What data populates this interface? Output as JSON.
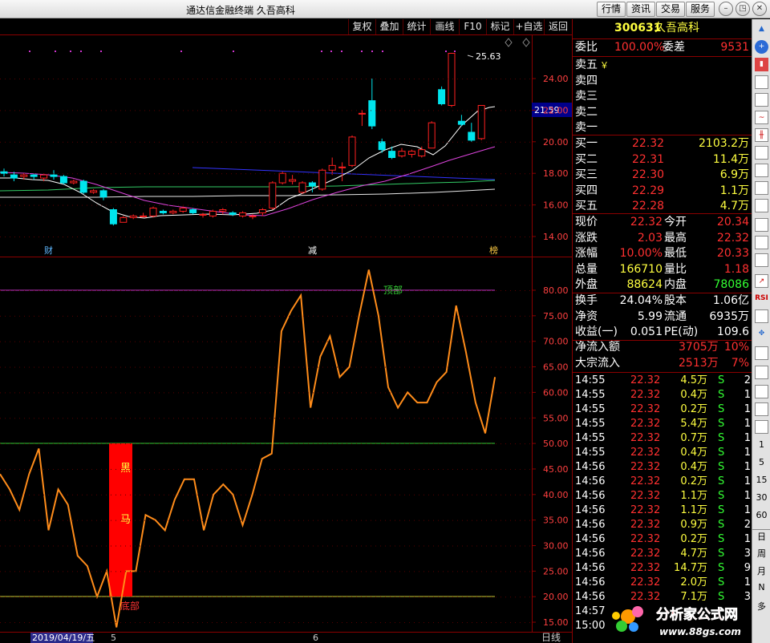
{
  "app": {
    "title": "通达信金融终端 久吾高科",
    "buttons": [
      "行情",
      "资讯",
      "交易",
      "服务"
    ]
  },
  "toolbar": {
    "items": [
      "复权",
      "叠加",
      "统计",
      "画线",
      "F10",
      "标记",
      "+自选",
      "返回"
    ]
  },
  "kline": {
    "price_axis": [
      "24.00",
      "22.00",
      "20.00",
      "18.00",
      "16.00",
      "14.00"
    ],
    "high_label": "25.63",
    "current_price_tag": "21.59",
    "markers": [
      "财",
      "减",
      "榜"
    ],
    "candles": [
      {
        "o": 18.1,
        "c": 18.0,
        "h": 18.3,
        "l": 17.8
      },
      {
        "o": 17.9,
        "c": 17.7,
        "h": 18.1,
        "l": 17.5
      },
      {
        "o": 17.8,
        "c": 17.9,
        "h": 18.0,
        "l": 17.6
      },
      {
        "o": 17.9,
        "c": 17.8,
        "h": 18.0,
        "l": 17.6
      },
      {
        "o": 17.7,
        "c": 17.9,
        "h": 18.0,
        "l": 17.5
      },
      {
        "o": 17.9,
        "c": 17.8,
        "h": 18.2,
        "l": 17.6
      },
      {
        "o": 17.8,
        "c": 17.4,
        "h": 17.9,
        "l": 17.3
      },
      {
        "o": 17.4,
        "c": 17.5,
        "h": 17.6,
        "l": 17.3
      },
      {
        "o": 17.5,
        "c": 16.8,
        "h": 17.6,
        "l": 16.7
      },
      {
        "o": 16.8,
        "c": 16.9,
        "h": 17.0,
        "l": 16.7
      },
      {
        "o": 16.9,
        "c": 16.5,
        "h": 17.0,
        "l": 16.3
      },
      {
        "o": 15.7,
        "c": 14.8,
        "h": 15.8,
        "l": 14.7
      },
      {
        "o": 14.9,
        "c": 15.2,
        "h": 15.3,
        "l": 14.9
      },
      {
        "o": 15.2,
        "c": 15.3,
        "h": 15.4,
        "l": 15.1
      },
      {
        "o": 15.3,
        "c": 15.3,
        "h": 15.5,
        "l": 15.2
      },
      {
        "o": 15.3,
        "c": 15.8,
        "h": 15.9,
        "l": 15.2
      },
      {
        "o": 15.6,
        "c": 15.5,
        "h": 15.7,
        "l": 15.4
      },
      {
        "o": 15.5,
        "c": 15.6,
        "h": 15.7,
        "l": 15.4
      },
      {
        "o": 15.6,
        "c": 15.8,
        "h": 15.9,
        "l": 15.5
      },
      {
        "o": 15.7,
        "c": 15.5,
        "h": 15.8,
        "l": 15.4
      },
      {
        "o": 15.4,
        "c": 15.4,
        "h": 15.5,
        "l": 15.2
      },
      {
        "o": 15.3,
        "c": 15.6,
        "h": 15.7,
        "l": 15.2
      },
      {
        "o": 15.6,
        "c": 15.7,
        "h": 15.8,
        "l": 15.4
      },
      {
        "o": 15.5,
        "c": 15.4,
        "h": 15.6,
        "l": 15.3
      },
      {
        "o": 15.3,
        "c": 15.5,
        "h": 15.6,
        "l": 15.2
      },
      {
        "o": 15.3,
        "c": 15.3,
        "h": 15.4,
        "l": 15.1
      },
      {
        "o": 15.5,
        "c": 15.7,
        "h": 15.8,
        "l": 15.3
      },
      {
        "o": 15.8,
        "c": 17.4,
        "h": 17.5,
        "l": 15.7
      },
      {
        "o": 17.4,
        "c": 18.0,
        "h": 18.1,
        "l": 17.3
      },
      {
        "o": 17.5,
        "c": 17.6,
        "h": 17.9,
        "l": 17.3
      },
      {
        "o": 16.8,
        "c": 17.4,
        "h": 17.5,
        "l": 16.7
      },
      {
        "o": 17.4,
        "c": 17.2,
        "h": 17.5,
        "l": 16.8
      },
      {
        "o": 17.0,
        "c": 18.2,
        "h": 18.3,
        "l": 16.9
      },
      {
        "o": 18.2,
        "c": 18.5,
        "h": 19.0,
        "l": 17.9
      },
      {
        "o": 18.4,
        "c": 18.4,
        "h": 18.7,
        "l": 17.5
      },
      {
        "o": 18.5,
        "c": 20.3,
        "h": 20.4,
        "l": 18.4
      },
      {
        "o": 21.8,
        "c": 21.8,
        "h": 22.0,
        "l": 21.0
      },
      {
        "o": 22.6,
        "c": 21.0,
        "h": 24.0,
        "l": 20.8
      },
      {
        "o": 20.0,
        "c": 19.5,
        "h": 20.2,
        "l": 19.3
      },
      {
        "o": 19.4,
        "c": 19.0,
        "h": 19.7,
        "l": 18.9
      },
      {
        "o": 19.1,
        "c": 19.4,
        "h": 19.6,
        "l": 19.0
      },
      {
        "o": 19.2,
        "c": 19.4,
        "h": 19.5,
        "l": 19.0
      },
      {
        "o": 19.1,
        "c": 19.5,
        "h": 19.7,
        "l": 19.0
      },
      {
        "o": 19.6,
        "c": 21.2,
        "h": 21.3,
        "l": 19.6
      },
      {
        "o": 23.3,
        "c": 22.4,
        "h": 23.5,
        "l": 22.3
      },
      {
        "o": 22.3,
        "c": 25.6,
        "h": 25.63,
        "l": 22.2
      },
      {
        "o": 21.3,
        "c": 21.1,
        "h": 21.7,
        "l": 21.0
      },
      {
        "o": 20.6,
        "c": 20.1,
        "h": 21.2,
        "l": 20.0
      },
      {
        "o": 20.2,
        "c": 22.3,
        "h": 22.3,
        "l": 20.1
      }
    ]
  },
  "indicator": {
    "axis": [
      "80.00",
      "75.00",
      "70.00",
      "65.00",
      "60.00",
      "55.00",
      "50.00",
      "45.00",
      "40.00",
      "35.00",
      "30.00",
      "25.00",
      "20.00",
      "15.00"
    ],
    "label_top": "顶部",
    "label_bottom": "底部",
    "bar_text": [
      "黑",
      "马"
    ],
    "series": [
      44,
      41,
      37,
      44,
      49,
      33,
      41,
      38,
      28,
      26,
      20,
      25,
      14,
      25,
      25,
      36,
      35,
      33,
      39,
      43,
      43,
      33,
      40,
      42,
      40,
      34,
      40,
      47,
      48,
      72,
      76,
      79,
      57,
      67,
      71,
      63,
      65,
      75,
      84,
      75,
      61,
      57,
      60,
      58,
      58,
      62,
      64,
      77,
      68,
      58,
      52,
      63
    ]
  },
  "footer": {
    "date": "2019/04/19/五",
    "month_labels": [
      "5",
      "6"
    ],
    "period": "日线"
  },
  "quote": {
    "code": "300631",
    "name": "久吾高科",
    "weibi": {
      "label": "委比",
      "value": "100.00%",
      "label2": "委差",
      "value2": "9531"
    },
    "sells": [
      {
        "label": "卖五",
        "suffix": "￥"
      },
      {
        "label": "卖四",
        "suffix": ""
      },
      {
        "label": "卖三",
        "suffix": ""
      },
      {
        "label": "卖二",
        "suffix": ""
      },
      {
        "label": "卖一",
        "suffix": ""
      }
    ],
    "buys": [
      {
        "label": "买一",
        "price": "22.32",
        "vol": "2103.2万"
      },
      {
        "label": "买二",
        "price": "22.31",
        "vol": "11.4万"
      },
      {
        "label": "买三",
        "price": "22.30",
        "vol": "6.9万"
      },
      {
        "label": "买四",
        "price": "22.29",
        "vol": "1.1万"
      },
      {
        "label": "买五",
        "price": "22.28",
        "vol": "4.7万"
      }
    ],
    "stats": [
      {
        "l1": "现价",
        "v1": "22.32",
        "l2": "今开",
        "v2": "20.34"
      },
      {
        "l1": "涨跌",
        "v1": "2.03",
        "l2": "最高",
        "v2": "22.32"
      },
      {
        "l1": "涨幅",
        "v1": "10.00%",
        "l2": "最低",
        "v2": "20.33"
      },
      {
        "l1": "总量",
        "v1": "166710",
        "l2": "量比",
        "v2": "1.18"
      },
      {
        "l1": "外盘",
        "v1": "88624",
        "l2": "内盘",
        "v2": "78086"
      }
    ],
    "stats2": [
      {
        "l1": "换手",
        "v1": "24.04%",
        "l2": "股本",
        "v2": "1.06亿"
      },
      {
        "l1": "净资",
        "v1": "5.99",
        "l2": "流通",
        "v2": "6935万"
      },
      {
        "l1": "收益(一)",
        "v1": "0.051",
        "l2": "PE(动)",
        "v2": "109.6"
      }
    ],
    "flows": [
      {
        "label": "净流入额",
        "value": "3705万",
        "pct": "10%"
      },
      {
        "label": "大宗流入",
        "value": "2513万",
        "pct": "7%"
      }
    ],
    "ticks": [
      {
        "t": "14:55",
        "p": "22.32",
        "v": "4.5万",
        "f": "S",
        "n": "2"
      },
      {
        "t": "14:55",
        "p": "22.32",
        "v": "0.4万",
        "f": "S",
        "n": "1"
      },
      {
        "t": "14:55",
        "p": "22.32",
        "v": "0.2万",
        "f": "S",
        "n": "1"
      },
      {
        "t": "14:55",
        "p": "22.32",
        "v": "5.4万",
        "f": "S",
        "n": "1"
      },
      {
        "t": "14:55",
        "p": "22.32",
        "v": "0.7万",
        "f": "S",
        "n": "1"
      },
      {
        "t": "14:55",
        "p": "22.32",
        "v": "0.4万",
        "f": "S",
        "n": "1"
      },
      {
        "t": "14:56",
        "p": "22.32",
        "v": "0.4万",
        "f": "S",
        "n": "1"
      },
      {
        "t": "14:56",
        "p": "22.32",
        "v": "0.2万",
        "f": "S",
        "n": "1"
      },
      {
        "t": "14:56",
        "p": "22.32",
        "v": "1.1万",
        "f": "S",
        "n": "1"
      },
      {
        "t": "14:56",
        "p": "22.32",
        "v": "1.1万",
        "f": "S",
        "n": "1"
      },
      {
        "t": "14:56",
        "p": "22.32",
        "v": "0.9万",
        "f": "S",
        "n": "2"
      },
      {
        "t": "14:56",
        "p": "22.32",
        "v": "0.2万",
        "f": "S",
        "n": "1"
      },
      {
        "t": "14:56",
        "p": "22.32",
        "v": "4.7万",
        "f": "S",
        "n": "3"
      },
      {
        "t": "14:56",
        "p": "22.32",
        "v": "14.7万",
        "f": "S",
        "n": "9"
      },
      {
        "t": "14:56",
        "p": "22.32",
        "v": "2.0万",
        "f": "S",
        "n": "1"
      },
      {
        "t": "14:56",
        "p": "22.32",
        "v": "7.1万",
        "f": "S",
        "n": "3"
      },
      {
        "t": "14:57",
        "p": "",
        "v": "",
        "f": "",
        "n": ""
      },
      {
        "t": "15:00",
        "p": "",
        "v": "",
        "f": "",
        "n": ""
      }
    ]
  },
  "sidebar": {
    "numbers": [
      "1",
      "5",
      "15",
      "30",
      "60"
    ],
    "period_labels": [
      "日",
      "周",
      "月",
      "N",
      "多"
    ]
  },
  "watermark": {
    "title": "分析家公式网",
    "url": "www.88gs.com"
  },
  "colors": {
    "up": "#ff2020",
    "down": "#00e5ee",
    "price": "#ff3030",
    "volume": "#ffff40",
    "accent": "#ff8c1a",
    "neutral": "#ffffff"
  }
}
